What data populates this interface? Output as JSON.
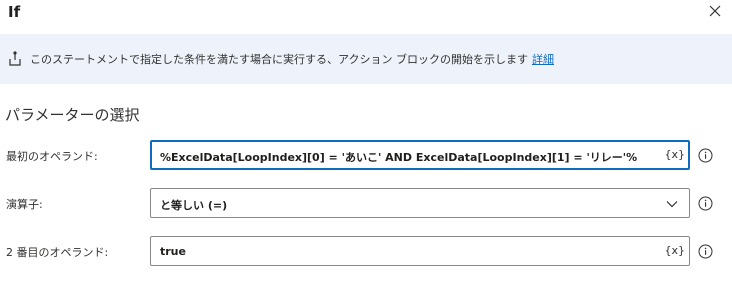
{
  "dialog": {
    "title": "If",
    "close_icon": "close-icon"
  },
  "info": {
    "icon": "branch-icon",
    "text": "このステートメントで指定した条件を満たす場合に実行する、アクション ブロックの開始を示します",
    "link": "詳細"
  },
  "section": {
    "title": "パラメーターの選択"
  },
  "params": {
    "first_operand": {
      "label": "最初のオペランド:",
      "value": "%ExcelData[LoopIndex][0] = 'あいこ' AND ExcelData[LoopIndex][1] = 'リレー'%",
      "var_button": "{x}"
    },
    "operator": {
      "label": "演算子:",
      "value": "と等しい (=)"
    },
    "second_operand": {
      "label": "2 番目のオペランド:",
      "value": "true",
      "var_button": "{x}"
    }
  },
  "colors": {
    "accent": "#0f6cbd",
    "info_bg": "#eef3fb"
  }
}
